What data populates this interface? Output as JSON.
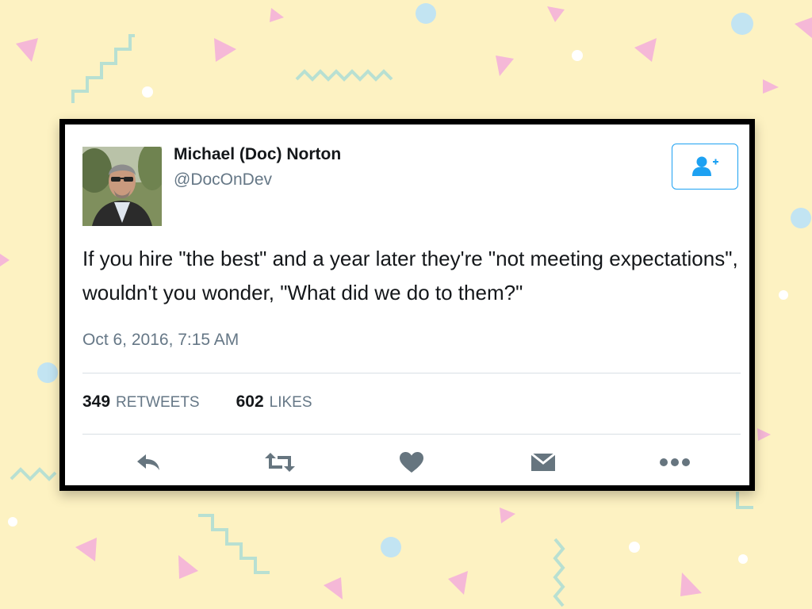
{
  "tweet": {
    "author_name": "Michael (Doc) Norton",
    "handle": "@DocOnDev",
    "text": "If you hire \"the best\" and a year later they're \"not meeting expectations\", wouldn't you wonder, \"What did we do to them?\"",
    "timestamp": "Oct 6, 2016, 7:15 AM",
    "retweets_count": "349",
    "retweets_label": "RETWEETS",
    "likes_count": "602",
    "likes_label": "LIKES"
  },
  "icons": {
    "follow": "add-user-icon",
    "reply": "reply-icon",
    "retweet": "retweet-icon",
    "like": "heart-icon",
    "message": "envelope-icon",
    "more": "more-dots-icon"
  },
  "colors": {
    "background": "#fdf2c2",
    "accent": "#1da1f2",
    "icon_gray": "#66757f",
    "confetti_pink": "#f5b8d7",
    "confetti_blue": "#c2e4f2",
    "confetti_mint": "#b8e0d2"
  }
}
